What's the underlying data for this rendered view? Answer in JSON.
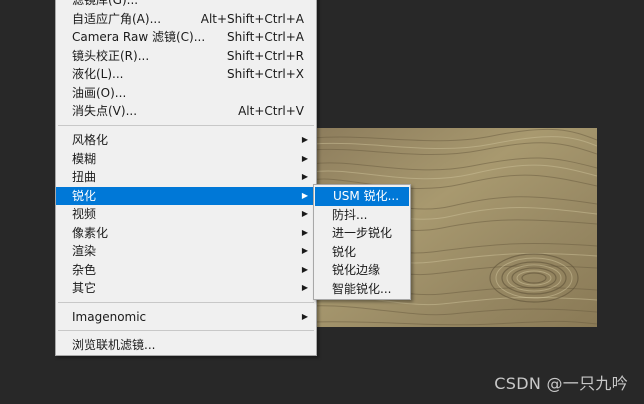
{
  "filter_menu": {
    "items_top": [
      {
        "label": "滤镜库(G)...",
        "shortcut": ""
      },
      {
        "label": "自适应广角(A)...",
        "shortcut": "Alt+Shift+Ctrl+A"
      },
      {
        "label": "Camera Raw 滤镜(C)...",
        "shortcut": "Shift+Ctrl+A"
      },
      {
        "label": "镜头校正(R)...",
        "shortcut": "Shift+Ctrl+R"
      },
      {
        "label": "液化(L)...",
        "shortcut": "Shift+Ctrl+X"
      },
      {
        "label": "油画(O)...",
        "shortcut": ""
      },
      {
        "label": "消失点(V)...",
        "shortcut": "Alt+Ctrl+V"
      }
    ],
    "items_groups": [
      {
        "label": "风格化"
      },
      {
        "label": "模糊"
      },
      {
        "label": "扭曲"
      },
      {
        "label": "锐化"
      },
      {
        "label": "视频"
      },
      {
        "label": "像素化"
      },
      {
        "label": "渲染"
      },
      {
        "label": "杂色"
      },
      {
        "label": "其它"
      }
    ],
    "items_plugins": [
      {
        "label": "Imagenomic"
      }
    ],
    "items_bottom": [
      {
        "label": "浏览联机滤镜..."
      }
    ],
    "arrow_glyph": "▶"
  },
  "sharpen_submenu": {
    "items": [
      {
        "label": "USM 锐化..."
      },
      {
        "label": "防抖..."
      },
      {
        "label": "进一步锐化"
      },
      {
        "label": "锐化"
      },
      {
        "label": "锐化边缘"
      },
      {
        "label": "智能锐化..."
      }
    ]
  },
  "watermark": "CSDN @一只九吟",
  "colors": {
    "highlight": "#0078d7",
    "menu_bg": "#f0f0f0",
    "workspace_bg": "#282828"
  }
}
